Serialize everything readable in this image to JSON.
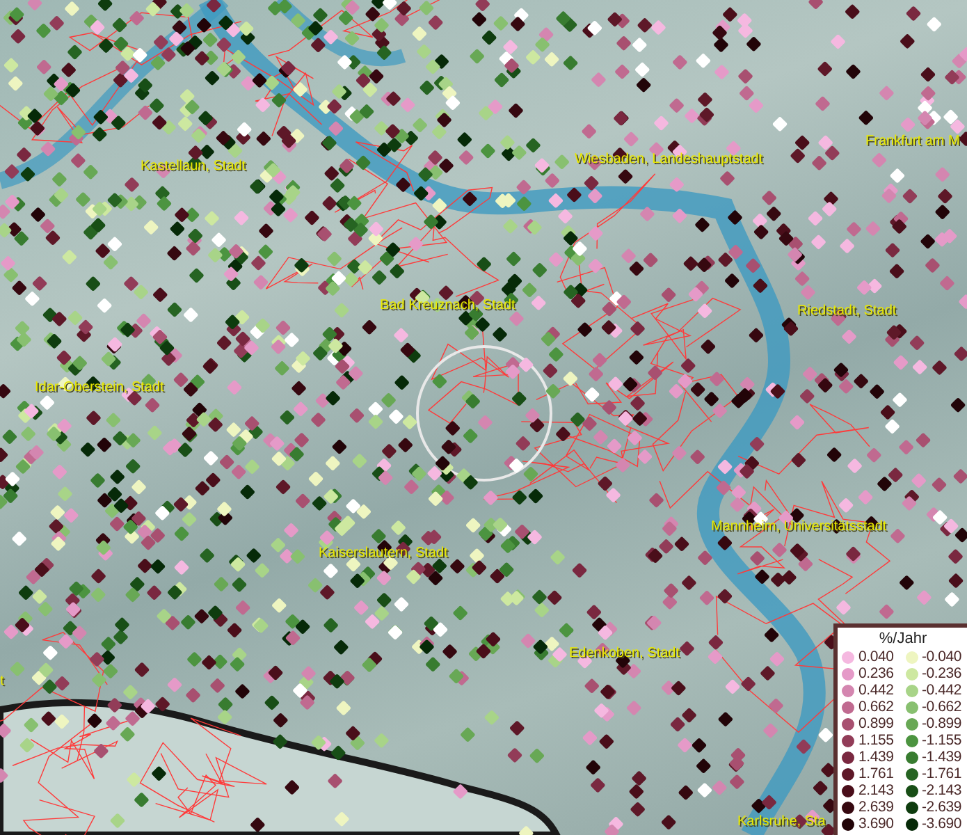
{
  "map": {
    "labels": [
      {
        "text": "Kastellaun, Stadt"
      },
      {
        "text": "Wiesbaden, Landeshauptstadt"
      },
      {
        "text": "Frankfurt am M"
      },
      {
        "text": "Bad Kreuznach, Stadt"
      },
      {
        "text": "Riedstadt, Stadt"
      },
      {
        "text": "Idar-Oberstein, Stadt"
      },
      {
        "text": "Mannheim, Universitätsstadt"
      },
      {
        "text": "Kaiserslautern, Stadt"
      },
      {
        "text": "Edenkoben, Stadt"
      },
      {
        "text": "t"
      },
      {
        "text": "Karlsruhe, Sta"
      }
    ]
  },
  "legend": {
    "title": "%/Jahr",
    "rows": [
      {
        "left": {
          "value": "0.040",
          "color": "#f5b8e0"
        },
        "right": {
          "value": "-0.040",
          "color": "#eef5c0"
        }
      },
      {
        "left": {
          "value": "0.236",
          "color": "#e59ac8"
        },
        "right": {
          "value": "-0.236",
          "color": "#cde8a0"
        }
      },
      {
        "left": {
          "value": "0.442",
          "color": "#d486b0"
        },
        "right": {
          "value": "-0.442",
          "color": "#a8d488"
        }
      },
      {
        "left": {
          "value": "0.662",
          "color": "#c06a90"
        },
        "right": {
          "value": "-0.662",
          "color": "#88c070"
        }
      },
      {
        "left": {
          "value": "0.899",
          "color": "#a85070"
        },
        "right": {
          "value": "-0.899",
          "color": "#68a855"
        }
      },
      {
        "left": {
          "value": "1.155",
          "color": "#923c58"
        },
        "right": {
          "value": "-1.155",
          "color": "#4c9440"
        }
      },
      {
        "left": {
          "value": "1.439",
          "color": "#7a2840"
        },
        "right": {
          "value": "-1.439",
          "color": "#387c30"
        }
      },
      {
        "left": {
          "value": "1.761",
          "color": "#5e1828"
        },
        "right": {
          "value": "-1.761",
          "color": "#266422"
        }
      },
      {
        "left": {
          "value": "2.143",
          "color": "#4a0e1a"
        },
        "right": {
          "value": "-2.143",
          "color": "#184e16"
        }
      },
      {
        "left": {
          "value": "2.639",
          "color": "#360810"
        },
        "right": {
          "value": "-2.639",
          "color": "#0e3c0e"
        }
      },
      {
        "left": {
          "value": "3.690",
          "color": "#220408"
        },
        "right": {
          "value": "-3.690",
          "color": "#062a08"
        }
      }
    ]
  }
}
